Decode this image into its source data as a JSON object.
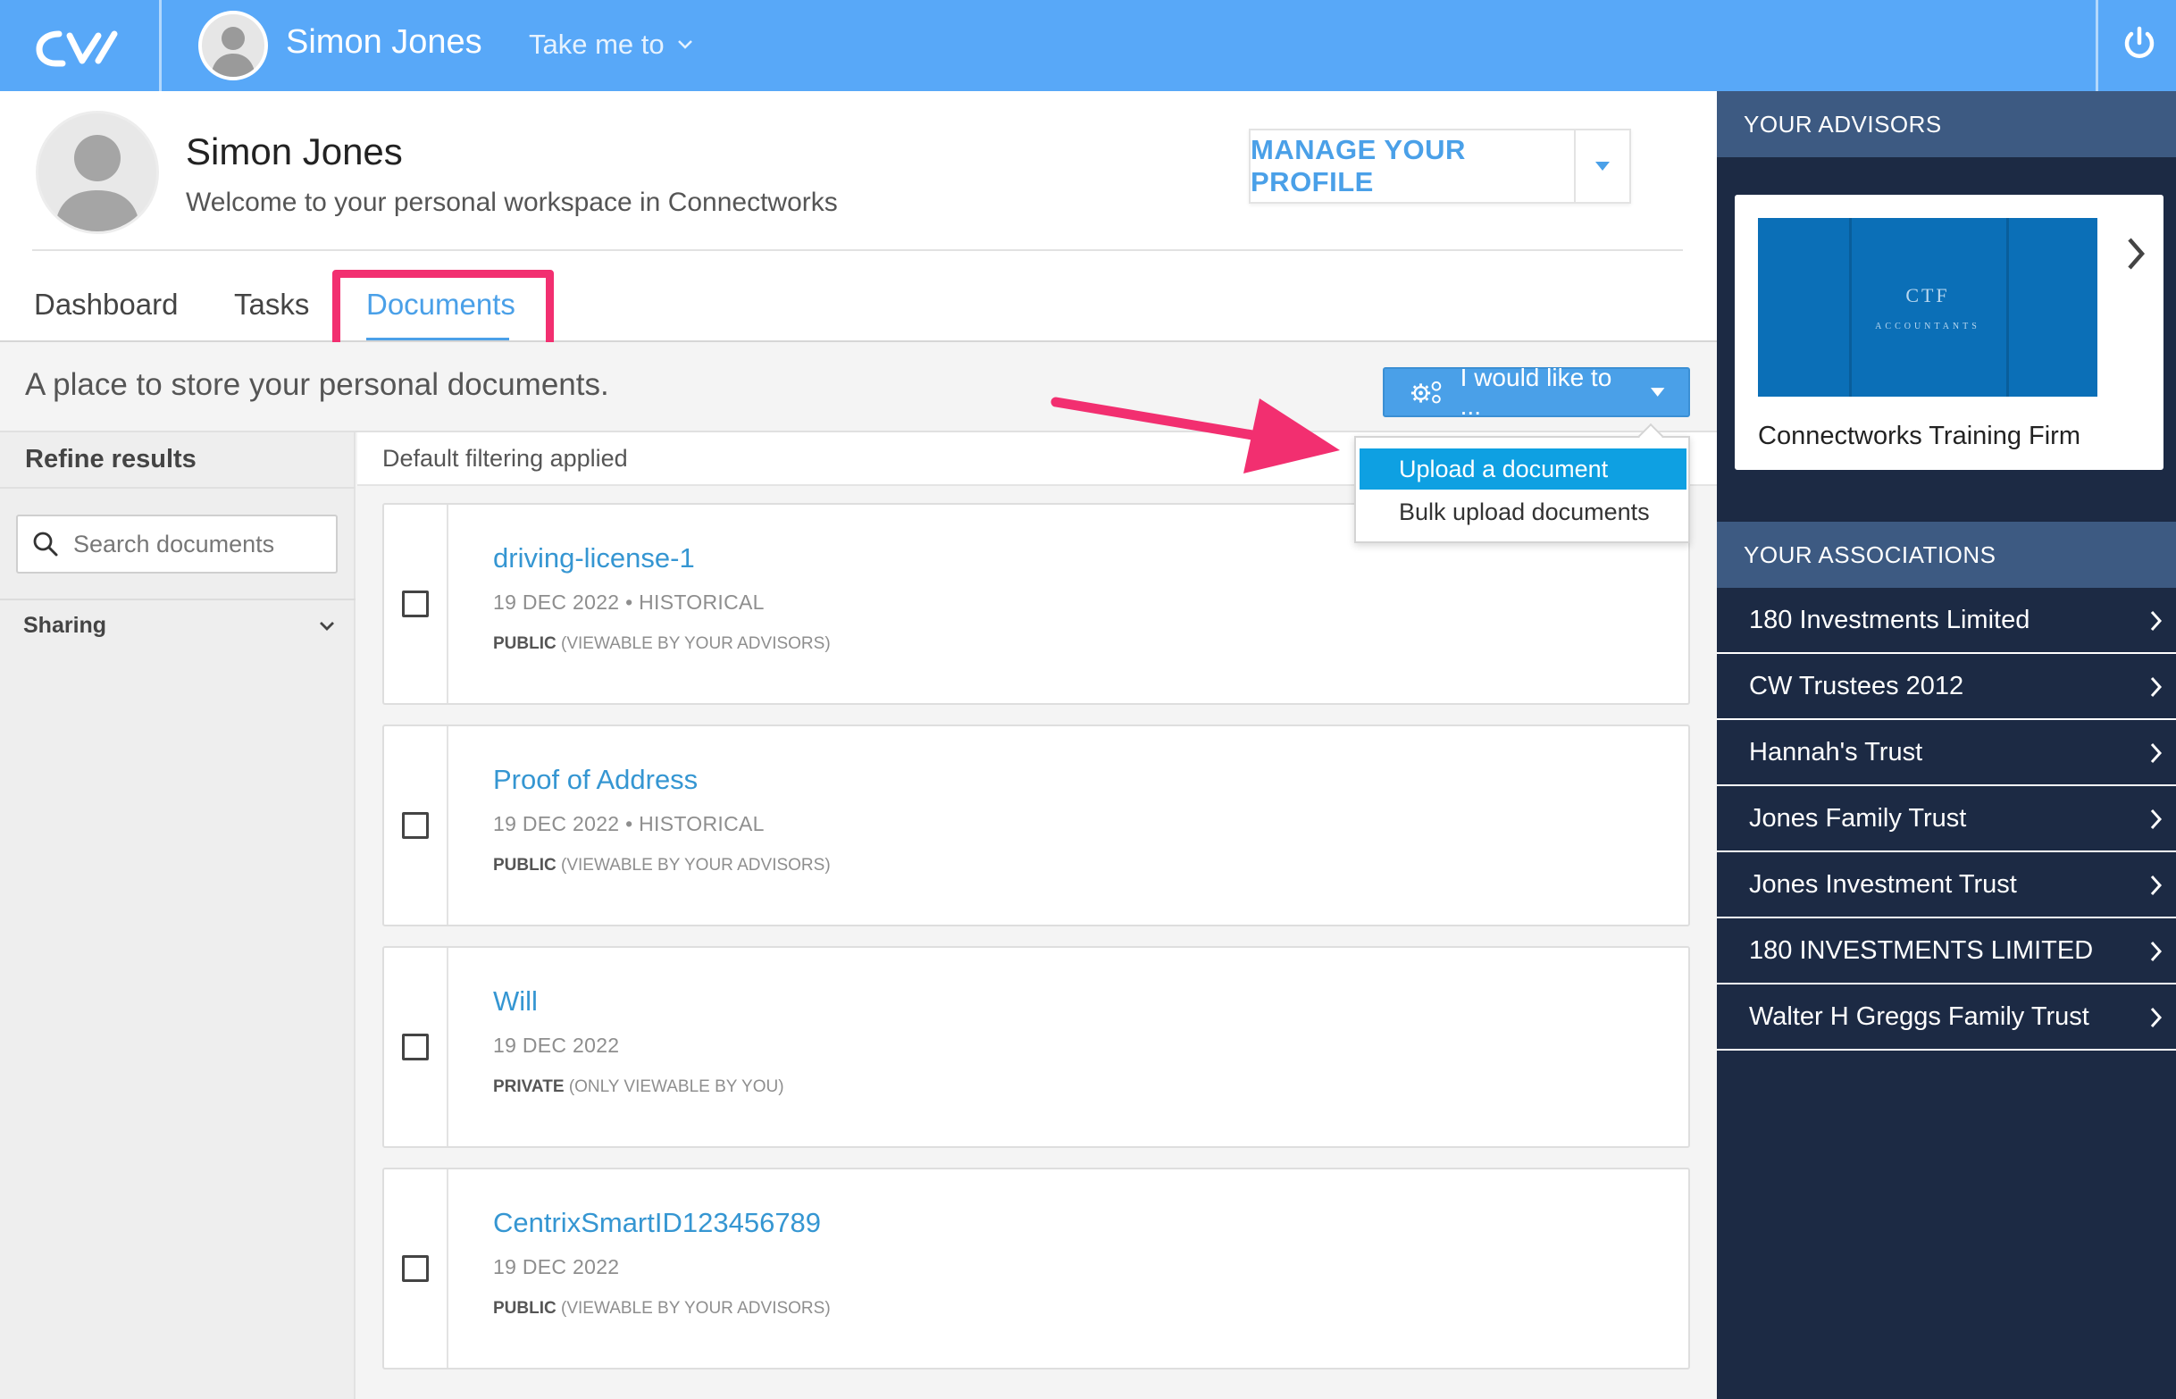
{
  "topbar": {
    "user_name": "Simon Jones",
    "take_me_to": "Take me to"
  },
  "profile": {
    "name": "Simon Jones",
    "welcome": "Welcome to your personal workspace in Connectworks",
    "manage_label": "MANAGE YOUR PROFILE"
  },
  "tabs": [
    {
      "label": "Dashboard"
    },
    {
      "label": "Tasks"
    },
    {
      "label": "Documents",
      "active": true
    }
  ],
  "documents_page": {
    "description": "A place to store your personal documents.",
    "action_button": "I would like to ...",
    "action_menu": [
      {
        "label": "Upload a document",
        "selected": true
      },
      {
        "label": "Bulk upload documents"
      }
    ],
    "filter_note": "Default filtering applied"
  },
  "refine": {
    "title": "Refine results",
    "search_placeholder": "Search documents",
    "sharing_label": "Sharing"
  },
  "documents": [
    {
      "title": "driving-license-1",
      "meta": "19 DEC 2022 • HISTORICAL",
      "visibility": "PUBLIC",
      "visibility_note": "(VIEWABLE BY YOUR ADVISORS)"
    },
    {
      "title": "Proof of Address",
      "meta": "19 DEC 2022 • HISTORICAL",
      "visibility": "PUBLIC",
      "visibility_note": "(VIEWABLE BY YOUR ADVISORS)"
    },
    {
      "title": "Will",
      "meta": "19 DEC 2022",
      "visibility": "PRIVATE",
      "visibility_note": "(ONLY VIEWABLE BY YOU)"
    },
    {
      "title": "CentrixSmartID123456789",
      "meta": "19 DEC 2022",
      "visibility": "PUBLIC",
      "visibility_note": "(VIEWABLE BY YOUR ADVISORS)"
    }
  ],
  "right_panel": {
    "advisors_header": "YOUR ADVISORS",
    "advisor": {
      "name": "Connectworks Training Firm",
      "logo_text": "CTF",
      "logo_sub": "ACCOUNTANTS"
    },
    "associations_header": "YOUR ASSOCIATIONS",
    "associations": [
      "180 Investments Limited",
      "CW Trustees 2012",
      "Hannah's Trust",
      "Jones Family Trust",
      "Jones Investment Trust",
      "180 INVESTMENTS LIMITED",
      "Walter H Greggs Family Trust"
    ]
  },
  "colors": {
    "topbar": "#58a8f8",
    "accent": "#4aa0e8",
    "link": "#3596d2",
    "highlight": "#f22f70",
    "menu_selected": "#0ea0e2",
    "panel_dark": "#1c2a44",
    "panel_header": "#3d5a82"
  },
  "icons": {
    "logo": "connectworks-logo",
    "power": "power-icon",
    "search": "search-icon",
    "gears": "gears-icon",
    "chevron": "chevron-right-icon"
  }
}
